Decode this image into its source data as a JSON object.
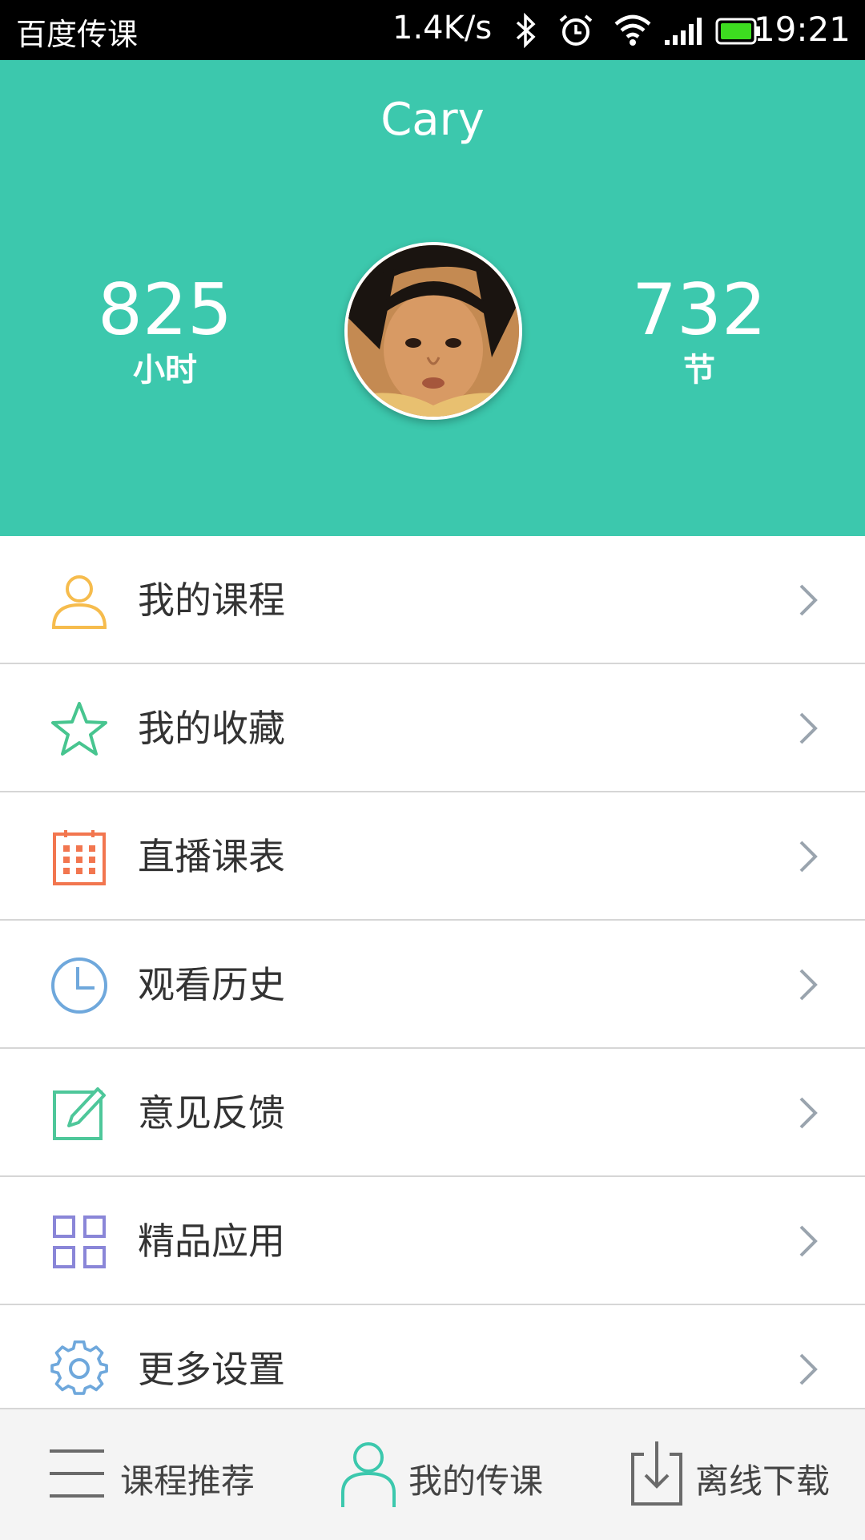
{
  "status_bar": {
    "app_name": "百度传课",
    "net_speed": "1.4K/s",
    "time": "19:21",
    "icons": [
      "bluetooth-icon",
      "alarm-icon",
      "wifi-icon",
      "signal-icon",
      "battery-icon"
    ]
  },
  "profile": {
    "username": "Cary",
    "hours_value": "825",
    "hours_unit": "小时",
    "lessons_value": "732",
    "lessons_unit": "节",
    "accent_color": "#3cc8ad"
  },
  "menu": {
    "items": [
      {
        "label": "我的课程",
        "icon": "person-icon",
        "color": "#f6bc4d"
      },
      {
        "label": "我的收藏",
        "icon": "star-icon",
        "color": "#47c58f"
      },
      {
        "label": "直播课表",
        "icon": "calendar-icon",
        "color": "#f2764f"
      },
      {
        "label": "观看历史",
        "icon": "clock-icon",
        "color": "#6fa8dc"
      },
      {
        "label": "意见反馈",
        "icon": "edit-icon",
        "color": "#4ec79a"
      },
      {
        "label": "精品应用",
        "icon": "apps-grid-icon",
        "color": "#8a86d8"
      },
      {
        "label": "更多设置",
        "icon": "gear-icon",
        "color": "#6fa8dc"
      }
    ]
  },
  "tabbar": {
    "tabs": [
      {
        "label": "课程推荐",
        "icon": "menu-lines-icon"
      },
      {
        "label": "我的传课",
        "icon": "person-outline-icon",
        "active": true
      },
      {
        "label": "离线下载",
        "icon": "download-icon"
      }
    ]
  }
}
